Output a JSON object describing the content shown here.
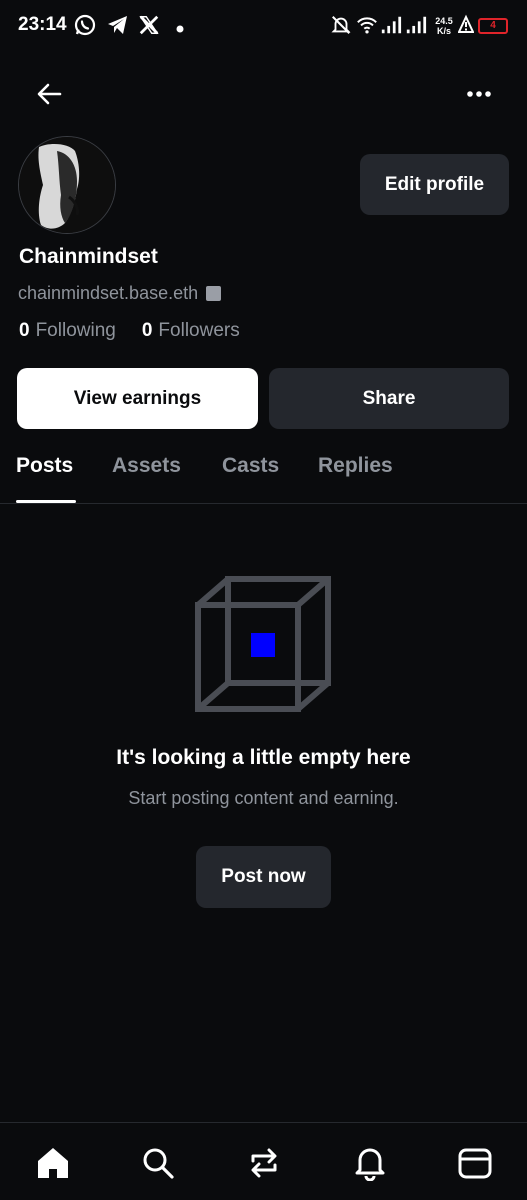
{
  "status_bar": {
    "time": "23:14",
    "icons": [
      "whatsapp-icon",
      "telegram-icon",
      "x-icon",
      "dot-icon",
      "bell-muted-icon",
      "wifi-icon",
      "signal-icon",
      "signal-icon",
      "alert-icon"
    ],
    "net_speed_value": "24.5",
    "net_speed_unit": "K/s",
    "battery_level": "4",
    "battery_color": "#e0242a"
  },
  "header": {
    "back_icon": "arrow-left-icon",
    "more_icon": "more-horizontal-icon"
  },
  "profile": {
    "display_name": "Chainmindset",
    "handle": "chainmindset.base.eth",
    "following_count": "0",
    "following_label": "Following",
    "followers_count": "0",
    "followers_label": "Followers",
    "edit_profile_label": "Edit profile",
    "view_earnings_label": "View earnings",
    "share_label": "Share"
  },
  "tabs": [
    {
      "label": "Posts",
      "active": true
    },
    {
      "label": "Assets",
      "active": false
    },
    {
      "label": "Casts",
      "active": false
    },
    {
      "label": "Replies",
      "active": false
    }
  ],
  "empty_state": {
    "title": "It's looking a little empty here",
    "subtitle": "Start posting content and earning.",
    "button_label": "Post now",
    "illustration": "cube-icon"
  },
  "bottom_nav": {
    "items": [
      "home-icon",
      "search-icon",
      "transfer-icon",
      "bell-icon",
      "wallet-icon"
    ]
  },
  "colors": {
    "background": "#0a0b0d",
    "surface": "#24272d",
    "muted_text": "#8f949c",
    "primary_text": "#ffffff",
    "accent_blue": "#0000ff"
  }
}
